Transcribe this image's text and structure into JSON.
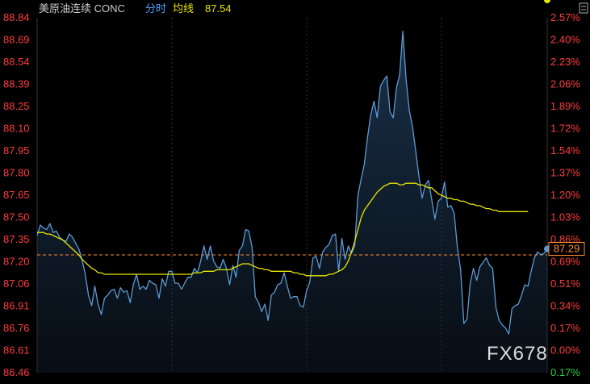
{
  "header": {
    "instrument": "美原油连续 CONC",
    "mode": "分时",
    "avg_label": "均线",
    "avg_value": "87.54"
  },
  "corner_icon": "settings-icon",
  "watermark": "FX678",
  "colors": {
    "background": "#000000",
    "price_line": "#5b9bd5",
    "avg_line": "#e6e600",
    "axis_text_left": "#ff3b3b",
    "axis_text_right_up": "#ff3b3b",
    "axis_text_right_down": "#2ecc40",
    "ref_line": "#ff8c2a",
    "header_text": "#cccccc",
    "header_mode": "#4aa3ff",
    "header_avg": "#e6e600",
    "price_tag_border": "#ff8c2a",
    "price_tag_text": "#ff8c2a",
    "grid": "#333333"
  },
  "chart_data": {
    "type": "line",
    "ylim": [
      86.46,
      88.84
    ],
    "y_ticks_left": [
      "88.84",
      "88.69",
      "88.54",
      "88.39",
      "88.25",
      "88.10",
      "87.95",
      "87.80",
      "87.65",
      "87.50",
      "87.35",
      "87.20",
      "87.06",
      "86.91",
      "86.76",
      "86.61",
      "86.46"
    ],
    "y_ticks_right": [
      "2.57%",
      "2.40%",
      "2.23%",
      "2.06%",
      "1.89%",
      "1.72%",
      "1.54%",
      "1.37%",
      "1.20%",
      "1.03%",
      "0.86%",
      "0.69%",
      "0.51%",
      "0.34%",
      "0.17%",
      "0.00%",
      "0.17%"
    ],
    "reference_price": 87.25,
    "last_price_label": "87.29",
    "grid": true,
    "series": [
      {
        "key": "price",
        "values": [
          87.38,
          87.45,
          87.43,
          87.42,
          87.46,
          87.4,
          87.41,
          87.37,
          87.35,
          87.34,
          87.39,
          87.37,
          87.33,
          87.29,
          87.22,
          87.12,
          86.98,
          86.91,
          87.04,
          86.92,
          86.85,
          86.96,
          86.98,
          87.01,
          87.02,
          86.96,
          87.03,
          87.0,
          87.01,
          86.93,
          87.05,
          87.12,
          87.02,
          87.04,
          87.02,
          87.08,
          87.06,
          87.05,
          86.96,
          87.09,
          87.04,
          87.14,
          87.14,
          87.06,
          87.06,
          87.02,
          87.06,
          87.1,
          87.1,
          87.16,
          87.13,
          87.21,
          87.31,
          87.22,
          87.31,
          87.21,
          87.17,
          87.16,
          87.22,
          87.16,
          87.05,
          87.18,
          87.1,
          87.28,
          87.31,
          87.42,
          87.41,
          87.3,
          86.97,
          86.93,
          86.87,
          86.92,
          86.81,
          86.98,
          87.0,
          87.05,
          87.06,
          87.13,
          87.04,
          86.96,
          86.97,
          86.97,
          86.91,
          86.9,
          87.01,
          87.07,
          87.23,
          87.24,
          87.16,
          87.27,
          87.3,
          87.32,
          87.38,
          87.39,
          87.14,
          87.36,
          87.22,
          87.31,
          87.26,
          87.31,
          87.65,
          87.76,
          87.86,
          88.04,
          88.19,
          88.28,
          88.17,
          88.38,
          88.42,
          88.45,
          88.21,
          88.17,
          88.37,
          88.46,
          88.75,
          88.43,
          88.22,
          88.11,
          87.95,
          87.78,
          87.63,
          87.72,
          87.75,
          87.62,
          87.49,
          87.61,
          87.63,
          87.74,
          87.57,
          87.58,
          87.53,
          87.3,
          87.15,
          86.79,
          86.82,
          87.06,
          87.16,
          87.08,
          87.17,
          87.2,
          87.23,
          87.18,
          87.16,
          86.9,
          86.81,
          86.78,
          86.76,
          86.72,
          86.89,
          86.91,
          86.92,
          86.98,
          87.05,
          87.04,
          87.14,
          87.23,
          87.27,
          87.25,
          87.26,
          87.29
        ]
      },
      {
        "key": "average",
        "values": [
          87.4,
          87.4,
          87.4,
          87.39,
          87.39,
          87.38,
          87.37,
          87.36,
          87.35,
          87.33,
          87.31,
          87.29,
          87.27,
          87.25,
          87.22,
          87.2,
          87.18,
          87.16,
          87.15,
          87.13,
          87.13,
          87.12,
          87.12,
          87.12,
          87.12,
          87.12,
          87.12,
          87.12,
          87.12,
          87.12,
          87.12,
          87.12,
          87.12,
          87.12,
          87.12,
          87.12,
          87.12,
          87.12,
          87.12,
          87.12,
          87.12,
          87.12,
          87.12,
          87.12,
          87.12,
          87.12,
          87.12,
          87.12,
          87.12,
          87.13,
          87.13,
          87.13,
          87.14,
          87.14,
          87.14,
          87.14,
          87.15,
          87.15,
          87.15,
          87.15,
          87.15,
          87.16,
          87.17,
          87.18,
          87.19,
          87.19,
          87.19,
          87.18,
          87.17,
          87.16,
          87.16,
          87.15,
          87.15,
          87.14,
          87.14,
          87.14,
          87.14,
          87.14,
          87.14,
          87.14,
          87.13,
          87.13,
          87.12,
          87.12,
          87.11,
          87.11,
          87.11,
          87.11,
          87.11,
          87.11,
          87.11,
          87.12,
          87.12,
          87.13,
          87.14,
          87.15,
          87.17,
          87.21,
          87.27,
          87.34,
          87.42,
          87.5,
          87.55,
          87.58,
          87.61,
          87.64,
          87.67,
          87.69,
          87.71,
          87.72,
          87.73,
          87.73,
          87.73,
          87.72,
          87.72,
          87.73,
          87.73,
          87.73,
          87.73,
          87.72,
          87.72,
          87.71,
          87.7,
          87.7,
          87.68,
          87.66,
          87.65,
          87.64,
          87.63,
          87.63,
          87.62,
          87.62,
          87.61,
          87.61,
          87.6,
          87.59,
          87.59,
          87.58,
          87.58,
          87.57,
          87.56,
          87.56,
          87.55,
          87.55,
          87.54,
          87.54,
          87.54,
          87.54,
          87.54,
          87.54,
          87.54,
          87.54,
          87.54,
          87.54
        ]
      }
    ]
  }
}
